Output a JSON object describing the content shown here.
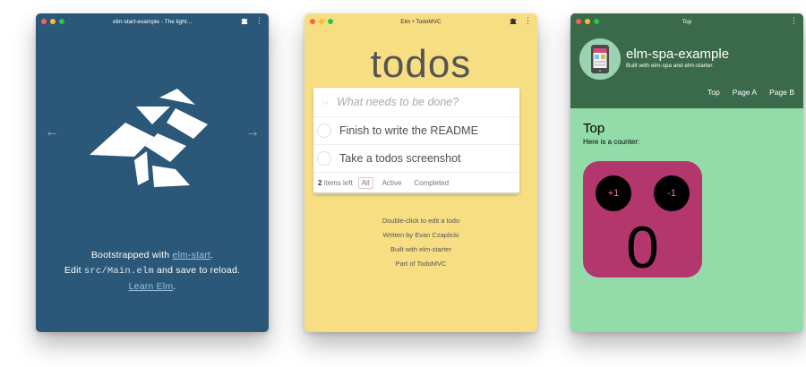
{
  "windows": [
    {
      "title": "elm-start-example - The light...",
      "text": {
        "line1_prefix": "Bootstrapped with",
        "line1_link": "elm-start",
        "line1_suffix": ".",
        "line2_prefix": "Edit",
        "line2_code": "src/Main.elm",
        "line2_suffix": "and save to reload.",
        "line3_link": "Learn Elm",
        "line3_suffix": "."
      }
    },
    {
      "title": "Elm • TodoMVC",
      "app_title": "todos",
      "input_placeholder": "What needs to be done?",
      "todos": [
        "Finish to write the README",
        "Take a todos screenshot"
      ],
      "footer": {
        "count": "2",
        "count_suffix": "items left",
        "filters": [
          "All",
          "Active",
          "Completed"
        ],
        "selected_filter": "All"
      },
      "info": [
        "Double-click to edit a todo",
        "Written by Evan Czaplicki",
        "Built with elm-starter",
        "Part of TodoMVC"
      ]
    },
    {
      "title": "Top",
      "app_name": "elm-spa-example",
      "app_subtitle": "Built with elm-spa and elm-starter.",
      "nav": [
        "Top",
        "Page A",
        "Page B"
      ],
      "heading": "Top",
      "description": "Here is a counter:",
      "counter": {
        "increment_label": "+1",
        "decrement_label": "-1",
        "value": "0"
      }
    }
  ],
  "icons": {
    "puzzle": "puzzle-icon",
    "menu": "menu-dots-icon",
    "left_arrow": "arrow-left-icon",
    "right_arrow": "arrow-right-icon",
    "toggle_all": "chevron-down-icon"
  },
  "colors": {
    "win1_bg": "#2b5878",
    "win2_bg": "#f8de83",
    "win3_header": "#3a6a4a",
    "win3_bg": "#93dca9",
    "counter_box": "#b3376d"
  }
}
